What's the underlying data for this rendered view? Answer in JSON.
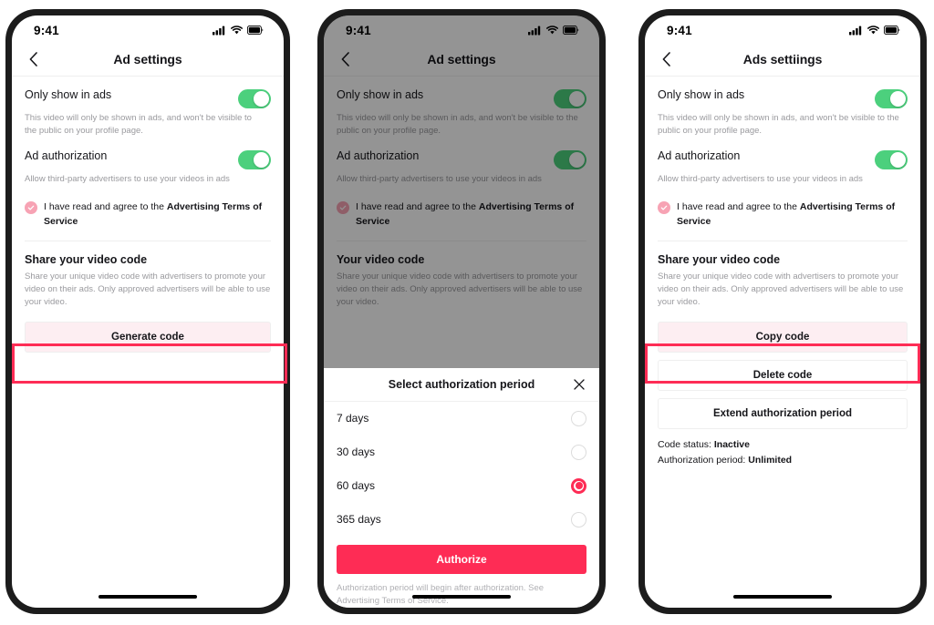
{
  "screens": [
    {
      "id": "screen-generate",
      "status_bar": {
        "time": "9:41",
        "icons": [
          "cellular-icon",
          "wifi-icon",
          "battery-icon"
        ]
      },
      "nav": {
        "back_icon": "chevron-left-icon",
        "title": "Ad settings"
      },
      "rows": [
        {
          "title": "Only show in ads",
          "desc": "This video will only be shown in ads, and won't be visible to the public on your profile page.",
          "toggle_on": true
        },
        {
          "title": "Ad authorization",
          "desc": "Allow third-party advertisers to use your videos in ads",
          "toggle_on": true
        }
      ],
      "agree": {
        "prefix": "I have read and agree to the ",
        "link": "Advertising Terms of Service",
        "checked": true
      },
      "section": {
        "title": "Share your video code",
        "desc": "Share your unique video code with advertisers to promote your video on their ads. Only approved advertisers will be able to use your video."
      },
      "buttons": [
        {
          "label": "Generate code",
          "style": "pinkfill",
          "highlighted": true
        }
      ]
    },
    {
      "id": "screen-authorization-period",
      "status_bar": {
        "time": "9:41",
        "icons": [
          "cellular-icon",
          "wifi-icon",
          "battery-icon"
        ]
      },
      "nav": {
        "back_icon": "chevron-left-icon",
        "title": "Ad settings"
      },
      "rows": [
        {
          "title": "Only show in ads",
          "desc": "This video will only be shown in ads, and won't be visible to the public on your profile page.",
          "toggle_on": true
        },
        {
          "title": "Ad authorization",
          "desc": "Allow third-party advertisers to use your videos in ads",
          "toggle_on": true
        }
      ],
      "agree": {
        "prefix": "I have read and agree to the ",
        "link": "Advertising Terms of Service",
        "checked": true
      },
      "section": {
        "title": "Your video code",
        "desc": "Share your unique video code with advertisers to promote your video on their ads. Only approved advertisers will be able to use your video."
      },
      "sheet": {
        "title": "Select authorization period",
        "close_icon": "close-icon",
        "options": [
          {
            "label": "7 days",
            "selected": false
          },
          {
            "label": "30 days",
            "selected": false
          },
          {
            "label": "60 days",
            "selected": true
          },
          {
            "label": "365 days",
            "selected": false
          }
        ],
        "primary_button": "Authorize",
        "footnote": "Authorization period will begin after authorization. See Advertising Terms of Service."
      }
    },
    {
      "id": "screen-code-actions",
      "status_bar": {
        "time": "9:41",
        "icons": [
          "cellular-icon",
          "wifi-icon",
          "battery-icon"
        ]
      },
      "nav": {
        "back_icon": "chevron-left-icon",
        "title": "Ads settiings"
      },
      "rows": [
        {
          "title": "Only show in ads",
          "desc": "This video will only be shown in ads, and won't be visible to the public on your profile page.",
          "toggle_on": true
        },
        {
          "title": "Ad authorization",
          "desc": "Allow third-party advertisers to use your videos in ads",
          "toggle_on": true
        }
      ],
      "agree": {
        "prefix": "I have read and agree to the ",
        "link": "Advertising Terms of Service",
        "checked": true
      },
      "section": {
        "title": "Share your video code",
        "desc": "Share your unique video code with advertisers to promote your video on their ads. Only approved advertisers will be able to use your video."
      },
      "buttons": [
        {
          "label": "Copy code",
          "style": "pinkfill",
          "highlighted": true
        },
        {
          "label": "Delete code",
          "style": "plain",
          "highlighted": false
        },
        {
          "label": "Extend authorization period",
          "style": "plain",
          "highlighted": false
        }
      ],
      "status": [
        {
          "label": "Code status:",
          "value": "Inactive"
        },
        {
          "label": "Authorization period:",
          "value": "Unlimited"
        }
      ]
    }
  ],
  "colors": {
    "accent_red": "#fe2c55",
    "toggle_green": "#4cd07d",
    "pink_fill": "#fdeef2",
    "check_pink": "#f7a3b4",
    "text_dark": "#16161a",
    "text_muted": "#9a9a9e"
  }
}
